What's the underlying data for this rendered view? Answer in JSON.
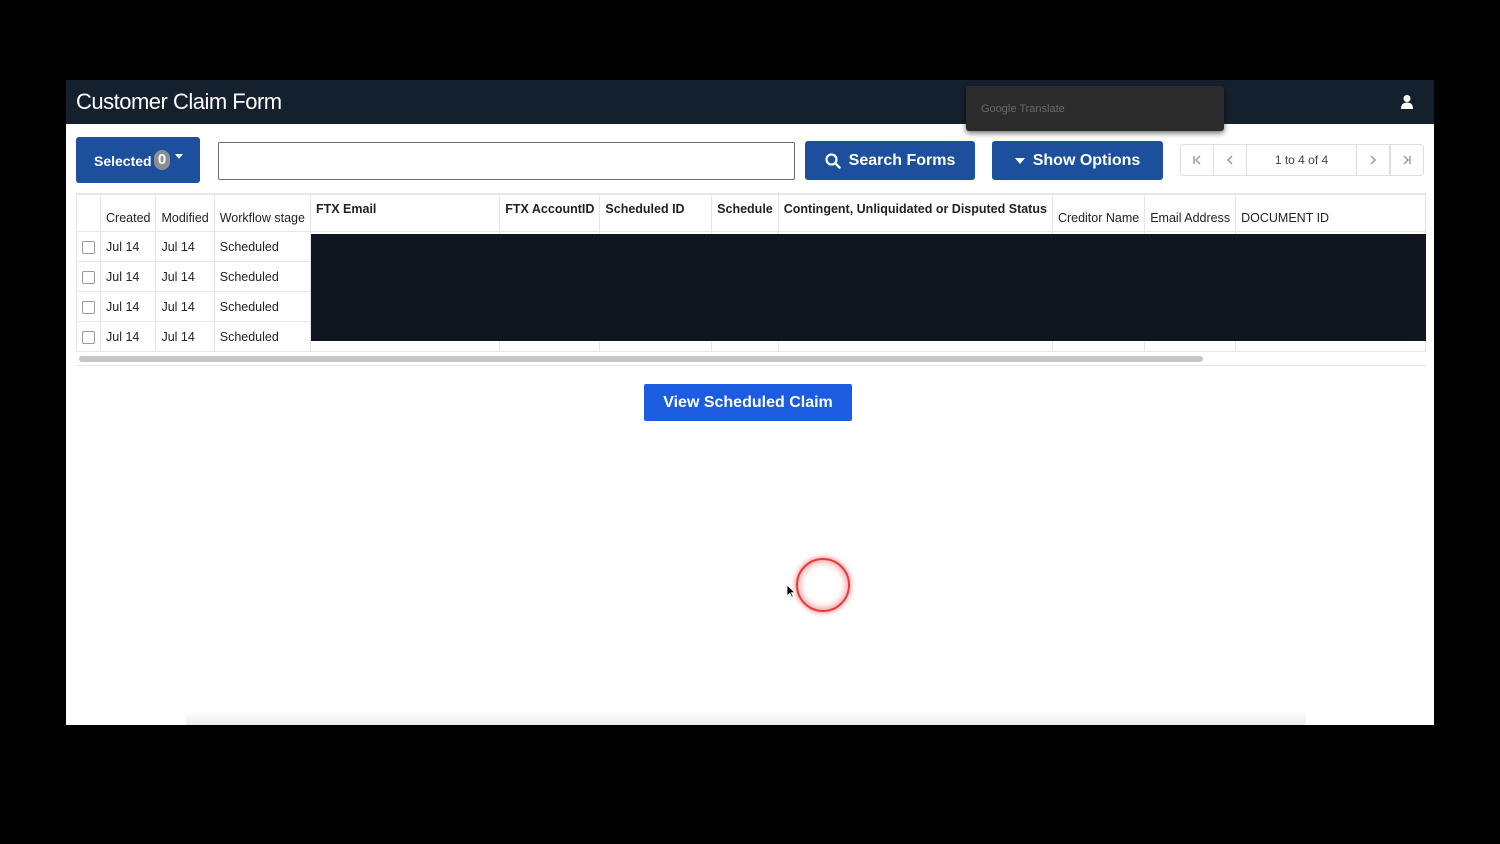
{
  "app": {
    "title": "Customer Claim Form"
  },
  "translate_popup": {
    "text": "Google Translate"
  },
  "toolbar": {
    "selected_label": "Selected",
    "selected_count": "0",
    "search_value": "",
    "search_button_label": "Search Forms",
    "options_button_label": "Show Options"
  },
  "pager": {
    "info": "1 to 4 of 4"
  },
  "table": {
    "columns": {
      "created": "Created",
      "modified": "Modified",
      "workflow_stage": "Workflow stage",
      "ftx_email": "FTX Email",
      "ftx_account_id": "FTX AccountID",
      "scheduled_id": "Scheduled ID",
      "schedule": "Schedule",
      "contingent": "Contingent, Unliquidated or Disputed Status",
      "creditor_name": "Creditor Name",
      "email_address": "Email Address",
      "document_id": "DOCUMENT ID"
    },
    "rows": [
      {
        "created": "Jul 14",
        "modified": "Jul 14",
        "stage": "Scheduled"
      },
      {
        "created": "Jul 14",
        "modified": "Jul 14",
        "stage": "Scheduled"
      },
      {
        "created": "Jul 14",
        "modified": "Jul 14",
        "stage": "Scheduled"
      },
      {
        "created": "Jul 14",
        "modified": "Jul 14",
        "stage": "Scheduled"
      }
    ]
  },
  "actions": {
    "view_scheduled_claim": "View Scheduled Claim"
  },
  "icons": [
    "user-icon",
    "search-icon",
    "caret-down-icon",
    "first-page-icon",
    "prev-page-icon",
    "next-page-icon",
    "last-page-icon",
    "cursor-icon"
  ],
  "colors": {
    "titlebar": "#15202e",
    "primary": "#1c4f9c",
    "view_button": "#1b5ce0",
    "redaction": "#101520"
  }
}
